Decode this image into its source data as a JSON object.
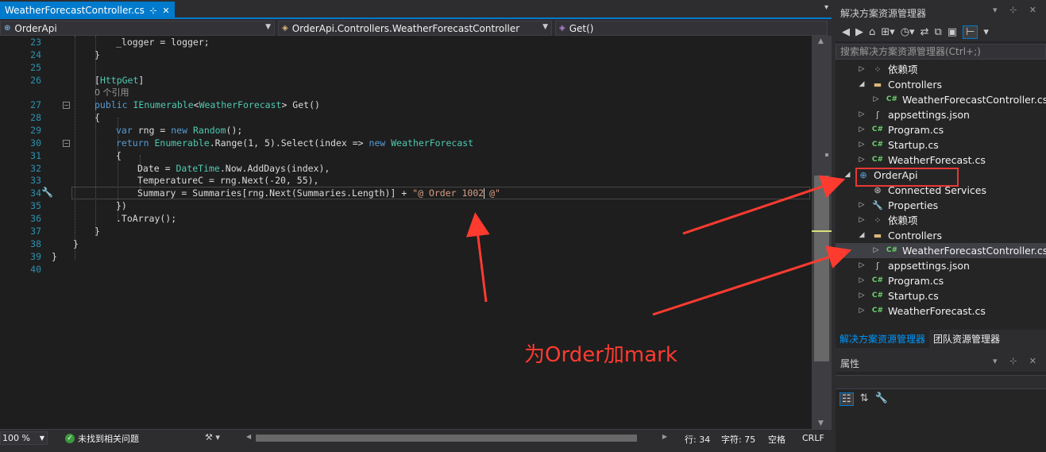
{
  "editor": {
    "tab_label": "WeatherForecastController.cs",
    "tab_pin": "⊹",
    "tab_close": "✕",
    "nav": {
      "project": "OrderApi",
      "class": "OrderApi.Controllers.WeatherForecastController",
      "member": "Get()"
    },
    "lines": [
      {
        "num": "23",
        "code": "_logger = logger;",
        "indent": 3
      },
      {
        "num": "24",
        "code": "}",
        "indent": 2
      },
      {
        "num": "25",
        "code": "",
        "indent": 0
      },
      {
        "num": "26",
        "code": "[HttpGet]",
        "indent": 2
      },
      {
        "num": "",
        "code": "0 个引用",
        "indent": 2
      },
      {
        "num": "27",
        "code": "public IEnumerable<WeatherForecast> Get()",
        "indent": 2
      },
      {
        "num": "28",
        "code": "{",
        "indent": 2
      },
      {
        "num": "29",
        "code": "var rng = new Random();",
        "indent": 3
      },
      {
        "num": "30",
        "code": "return Enumerable.Range(1, 5).Select(index => new WeatherForecast",
        "indent": 3
      },
      {
        "num": "31",
        "code": "{",
        "indent": 3
      },
      {
        "num": "32",
        "code": "Date = DateTime.Now.AddDays(index),",
        "indent": 4
      },
      {
        "num": "33",
        "code": "TemperatureC = rng.Next(-20, 55),",
        "indent": 4
      },
      {
        "num": "34",
        "code": "Summary = Summaries[rng.Next(Summaries.Length)] + \"@ Order 1002 @\"",
        "indent": 4
      },
      {
        "num": "35",
        "code": "})",
        "indent": 3
      },
      {
        "num": "36",
        "code": ".ToArray();",
        "indent": 3
      },
      {
        "num": "37",
        "code": "}",
        "indent": 2
      },
      {
        "num": "38",
        "code": "}",
        "indent": 1
      },
      {
        "num": "39",
        "code": "}",
        "indent": 0
      },
      {
        "num": "40",
        "code": "",
        "indent": 0
      }
    ]
  },
  "status": {
    "zoom": "100 %",
    "issues": "未找到相关问题",
    "line": "行: 34",
    "char": "字符: 75",
    "spaces": "空格",
    "eol": "CRLF"
  },
  "solution_explorer": {
    "title": "解决方案资源管理器",
    "search_placeholder": "搜索解决方案资源管理器(Ctrl+;)",
    "tree": [
      {
        "label": "依赖项",
        "icon": "dependencies-icon",
        "level": 1,
        "expander": "▷"
      },
      {
        "label": "Controllers",
        "icon": "folder-icon",
        "level": 1,
        "expander": "◢"
      },
      {
        "label": "WeatherForecastController.cs",
        "icon": "csharp-file-icon",
        "level": 2,
        "expander": "▷"
      },
      {
        "label": "appsettings.json",
        "icon": "json-file-icon",
        "level": 1,
        "expander": "▷"
      },
      {
        "label": "Program.cs",
        "icon": "csharp-file-icon",
        "level": 1,
        "expander": "▷"
      },
      {
        "label": "Startup.cs",
        "icon": "csharp-file-icon",
        "level": 1,
        "expander": "▷"
      },
      {
        "label": "WeatherForecast.cs",
        "icon": "csharp-file-icon",
        "level": 1,
        "expander": "▷"
      },
      {
        "label": "OrderApi",
        "icon": "web-project-icon",
        "level": 0,
        "expander": "◢"
      },
      {
        "label": "Connected Services",
        "icon": "connected-services-icon",
        "level": 1,
        "expander": ""
      },
      {
        "label": "Properties",
        "icon": "properties-icon",
        "level": 1,
        "expander": "▷"
      },
      {
        "label": "依赖项",
        "icon": "dependencies-icon",
        "level": 1,
        "expander": "▷"
      },
      {
        "label": "Controllers",
        "icon": "folder-icon",
        "level": 1,
        "expander": "◢"
      },
      {
        "label": "WeatherForecastController.cs",
        "icon": "csharp-file-icon",
        "level": 2,
        "expander": "▷",
        "selected": true
      },
      {
        "label": "appsettings.json",
        "icon": "json-file-icon",
        "level": 1,
        "expander": "▷"
      },
      {
        "label": "Program.cs",
        "icon": "csharp-file-icon",
        "level": 1,
        "expander": "▷"
      },
      {
        "label": "Startup.cs",
        "icon": "csharp-file-icon",
        "level": 1,
        "expander": "▷"
      },
      {
        "label": "WeatherForecast.cs",
        "icon": "csharp-file-icon",
        "level": 1,
        "expander": "▷"
      }
    ],
    "tabs": [
      "解决方案资源管理器",
      "团队资源管理器"
    ]
  },
  "properties": {
    "title": "属性"
  },
  "annotation": {
    "text": "为Order加mark",
    "color": "#ff3b30"
  },
  "colors": {
    "accent": "#007acc",
    "editor_bg": "#1e1e1e",
    "keyword": "#569cd6",
    "type": "#4ec9b0",
    "string": "#d69d85"
  }
}
